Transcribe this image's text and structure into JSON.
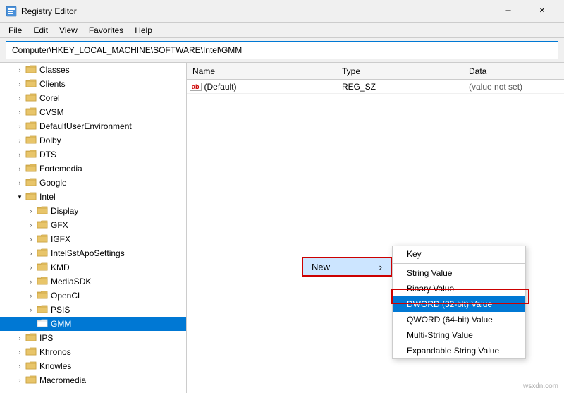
{
  "titleBar": {
    "title": "Registry Editor",
    "icon": "registry-icon",
    "minimizeLabel": "─",
    "closeLabel": "✕"
  },
  "menuBar": {
    "items": [
      "File",
      "Edit",
      "View",
      "Favorites",
      "Help"
    ]
  },
  "addressBar": {
    "path": "Computer\\HKEY_LOCAL_MACHINE\\SOFTWARE\\Intel\\GMM"
  },
  "treeItems": [
    {
      "label": "Classes",
      "indent": 1,
      "hasChildren": true,
      "expanded": false,
      "selected": false
    },
    {
      "label": "Clients",
      "indent": 1,
      "hasChildren": true,
      "expanded": false,
      "selected": false
    },
    {
      "label": "Corel",
      "indent": 1,
      "hasChildren": true,
      "expanded": false,
      "selected": false
    },
    {
      "label": "CVSM",
      "indent": 1,
      "hasChildren": true,
      "expanded": false,
      "selected": false
    },
    {
      "label": "DefaultUserEnvironment",
      "indent": 1,
      "hasChildren": true,
      "expanded": false,
      "selected": false
    },
    {
      "label": "Dolby",
      "indent": 1,
      "hasChildren": true,
      "expanded": false,
      "selected": false
    },
    {
      "label": "DTS",
      "indent": 1,
      "hasChildren": true,
      "expanded": false,
      "selected": false
    },
    {
      "label": "Fortemedia",
      "indent": 1,
      "hasChildren": true,
      "expanded": false,
      "selected": false
    },
    {
      "label": "Google",
      "indent": 1,
      "hasChildren": true,
      "expanded": false,
      "selected": false
    },
    {
      "label": "Intel",
      "indent": 1,
      "hasChildren": true,
      "expanded": true,
      "selected": false
    },
    {
      "label": "Display",
      "indent": 2,
      "hasChildren": true,
      "expanded": false,
      "selected": false
    },
    {
      "label": "GFX",
      "indent": 2,
      "hasChildren": true,
      "expanded": false,
      "selected": false
    },
    {
      "label": "IGFX",
      "indent": 2,
      "hasChildren": true,
      "expanded": false,
      "selected": false
    },
    {
      "label": "IntelSstApoSettings",
      "indent": 2,
      "hasChildren": true,
      "expanded": false,
      "selected": false
    },
    {
      "label": "KMD",
      "indent": 2,
      "hasChildren": true,
      "expanded": false,
      "selected": false
    },
    {
      "label": "MediaSDK",
      "indent": 2,
      "hasChildren": true,
      "expanded": false,
      "selected": false
    },
    {
      "label": "OpenCL",
      "indent": 2,
      "hasChildren": true,
      "expanded": false,
      "selected": false
    },
    {
      "label": "PSIS",
      "indent": 2,
      "hasChildren": true,
      "expanded": false,
      "selected": false
    },
    {
      "label": "GMM",
      "indent": 2,
      "hasChildren": false,
      "expanded": false,
      "selected": true
    },
    {
      "label": "IPS",
      "indent": 1,
      "hasChildren": true,
      "expanded": false,
      "selected": false
    },
    {
      "label": "Khronos",
      "indent": 1,
      "hasChildren": true,
      "expanded": false,
      "selected": false
    },
    {
      "label": "Knowles",
      "indent": 1,
      "hasChildren": true,
      "expanded": false,
      "selected": false
    },
    {
      "label": "Macromedia",
      "indent": 1,
      "hasChildren": true,
      "expanded": false,
      "selected": false
    }
  ],
  "tableColumns": {
    "name": "Name",
    "type": "Type",
    "data": "Data"
  },
  "tableRows": [
    {
      "icon": "ab",
      "name": "(Default)",
      "type": "REG_SZ",
      "data": "(value not set)"
    }
  ],
  "contextMenu": {
    "newLabel": "New",
    "arrowLabel": "›",
    "submenuItems": [
      {
        "label": "Key",
        "highlighted": false
      },
      {
        "label": "String Value",
        "highlighted": false
      },
      {
        "label": "Binary Value",
        "highlighted": false
      },
      {
        "label": "DWORD (32-bit) Value",
        "highlighted": true
      },
      {
        "label": "QWORD (64-bit) Value",
        "highlighted": false
      },
      {
        "label": "Multi-String Value",
        "highlighted": false
      },
      {
        "label": "Expandable String Value",
        "highlighted": false
      }
    ]
  },
  "colors": {
    "accent": "#0078d4",
    "selectedBg": "#0078d4",
    "highlightedBg": "#0078d4",
    "newBtnBorder": "#e00000",
    "newBtnBg": "#cce5ff"
  },
  "watermark": "wsxdn.com"
}
